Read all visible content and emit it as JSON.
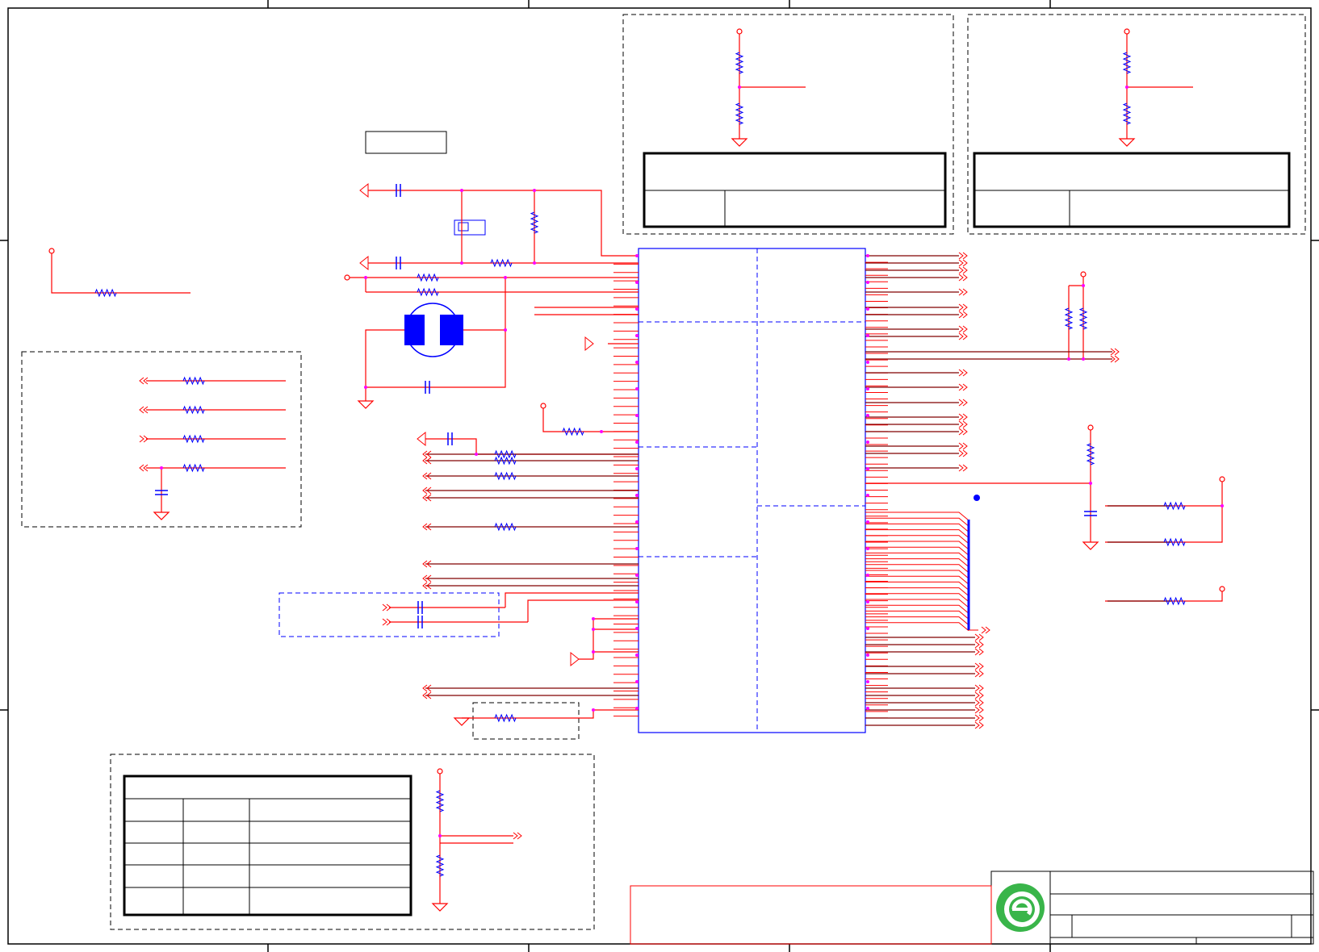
{
  "sheet": {
    "colors": {
      "frame": "#000000",
      "net": "#800000",
      "wire": "#ff0000",
      "part": "#0000ff",
      "junction": "#ff00ff",
      "ground": "#ff0000",
      "box": "#000000",
      "logo_ring": "#39b54a"
    }
  },
  "ic": {
    "left_pins": 56,
    "right_pins": 72
  },
  "logo": {
    "icon": "company-logo-icon"
  }
}
